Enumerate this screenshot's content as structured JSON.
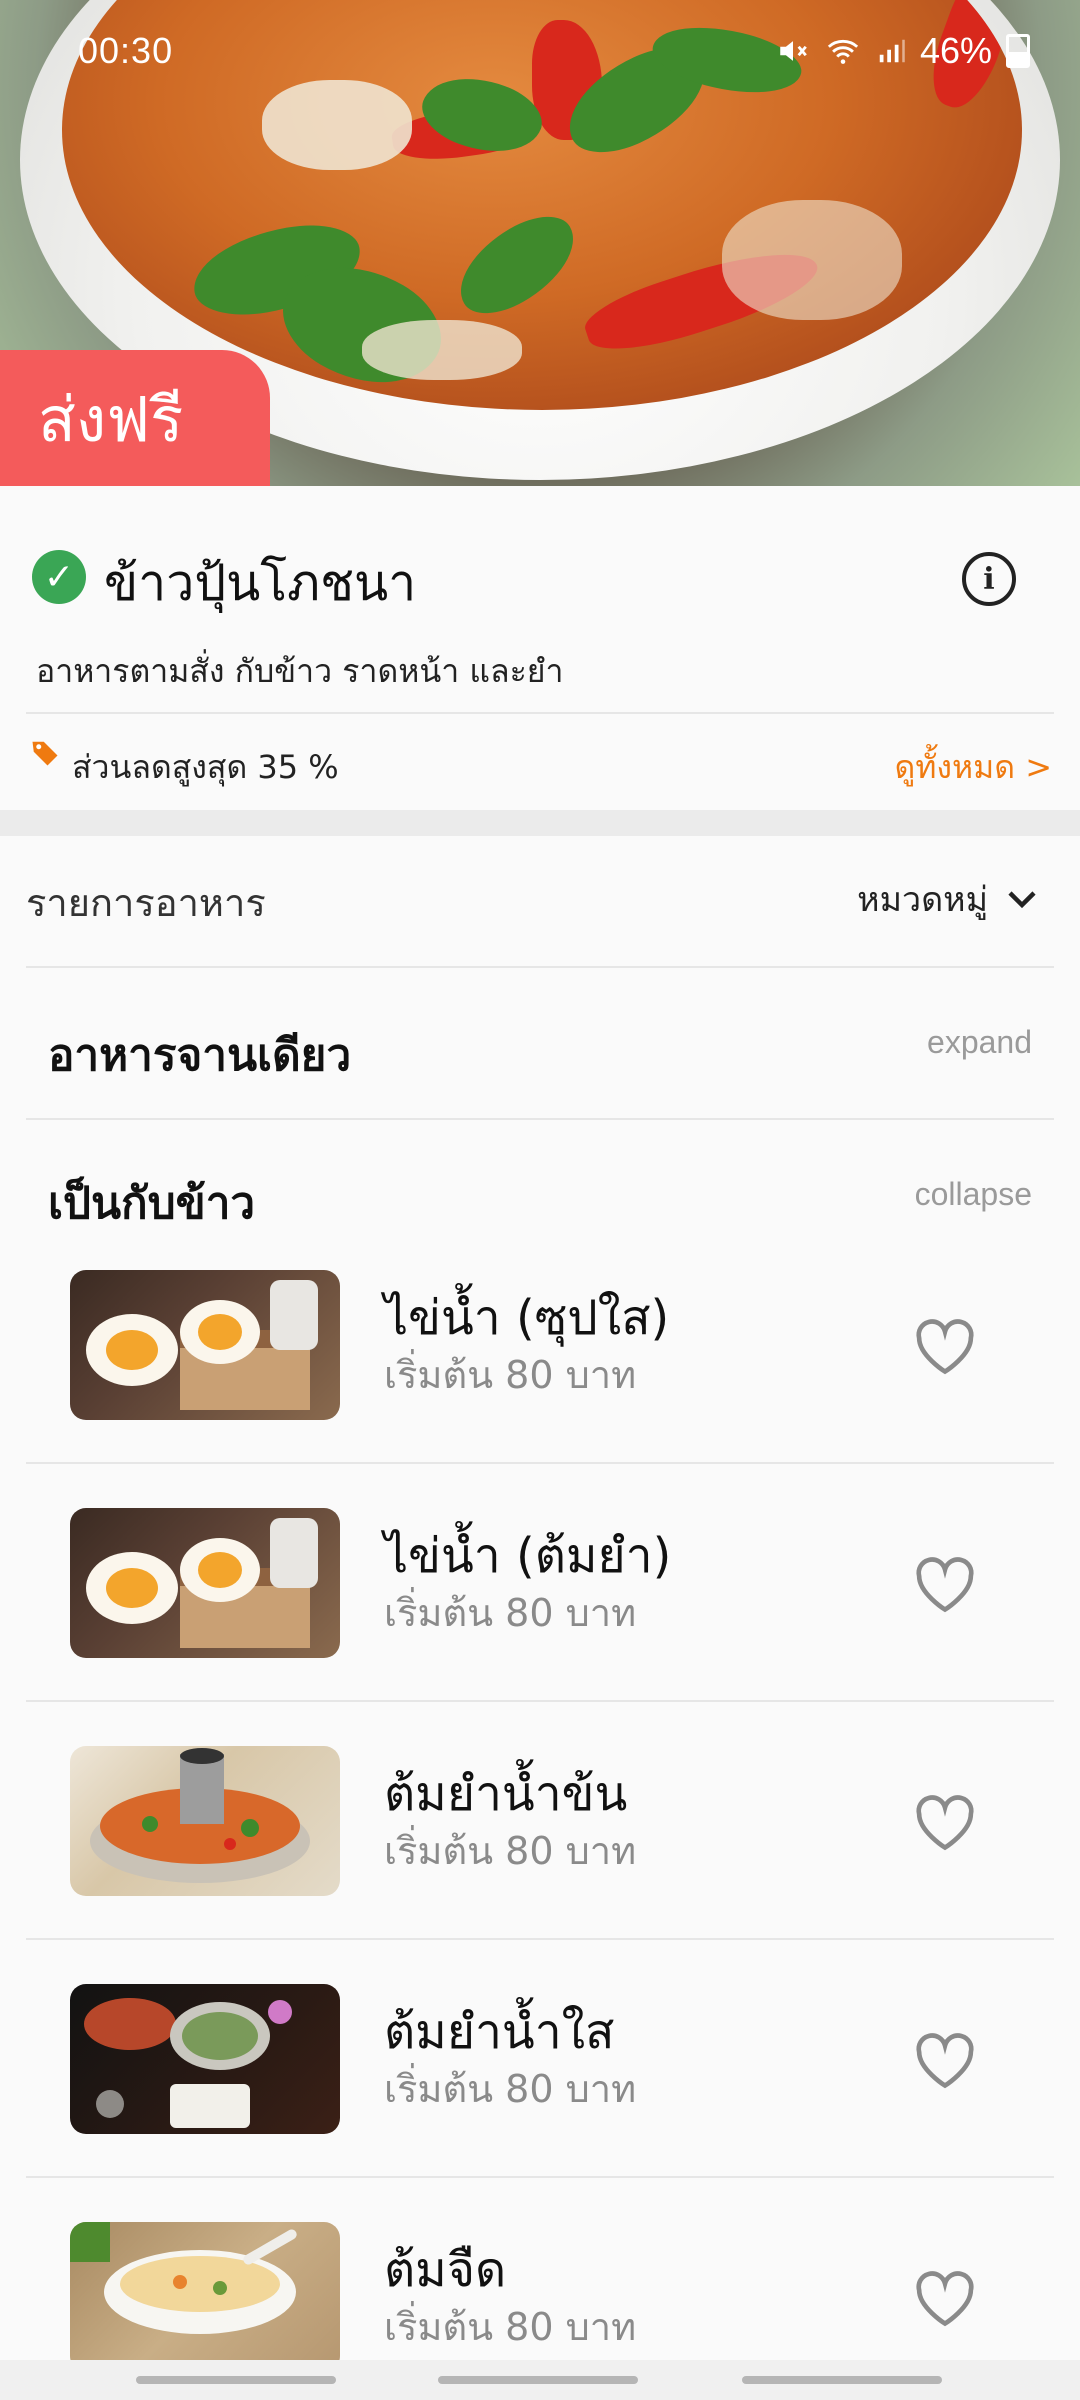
{
  "status_bar": {
    "time": "00:30",
    "battery": "46%"
  },
  "hero": {
    "promo_badge": "ส่งฟรี"
  },
  "store": {
    "name": "ข้าวปุ้นโภชนา",
    "description": "อาหารตามสั่ง กับข้าว ราดหน้า และยำ",
    "discount_text": "ส่วนลดสูงสุด 35 %",
    "view_all_label": "ดูทั้งหมด >",
    "accent_color": "#ef7a10",
    "badge_color": "#f45b5b"
  },
  "menu": {
    "title": "รายการอาหาร",
    "category_label": "หมวดหมู่",
    "sections": [
      {
        "title": "อาหารจานเดียว",
        "toggle_label": "expand"
      },
      {
        "title": "เป็นกับข้าว",
        "toggle_label": "collapse"
      }
    ],
    "items": [
      {
        "name": "ไข่น้ำ (ซุปใส)",
        "price": "เริ่มต้น 80 บาท",
        "image": "boiled-egg-photo"
      },
      {
        "name": "ไข่น้ำ (ต้มยำ)",
        "price": "เริ่มต้น 80 บาท",
        "image": "boiled-egg-photo"
      },
      {
        "name": "ต้มยำน้ำข้น",
        "price": "เริ่มต้น 80 บาท",
        "image": "tom-yum-pot-photo"
      },
      {
        "name": "ต้มยำน้ำใส",
        "price": "เริ่มต้น 80 บาท",
        "image": "seafood-table-photo"
      },
      {
        "name": "ต้มจืด",
        "price": "เริ่มต้น 80 บาท",
        "image": "clear-soup-bowl-photo"
      }
    ]
  }
}
